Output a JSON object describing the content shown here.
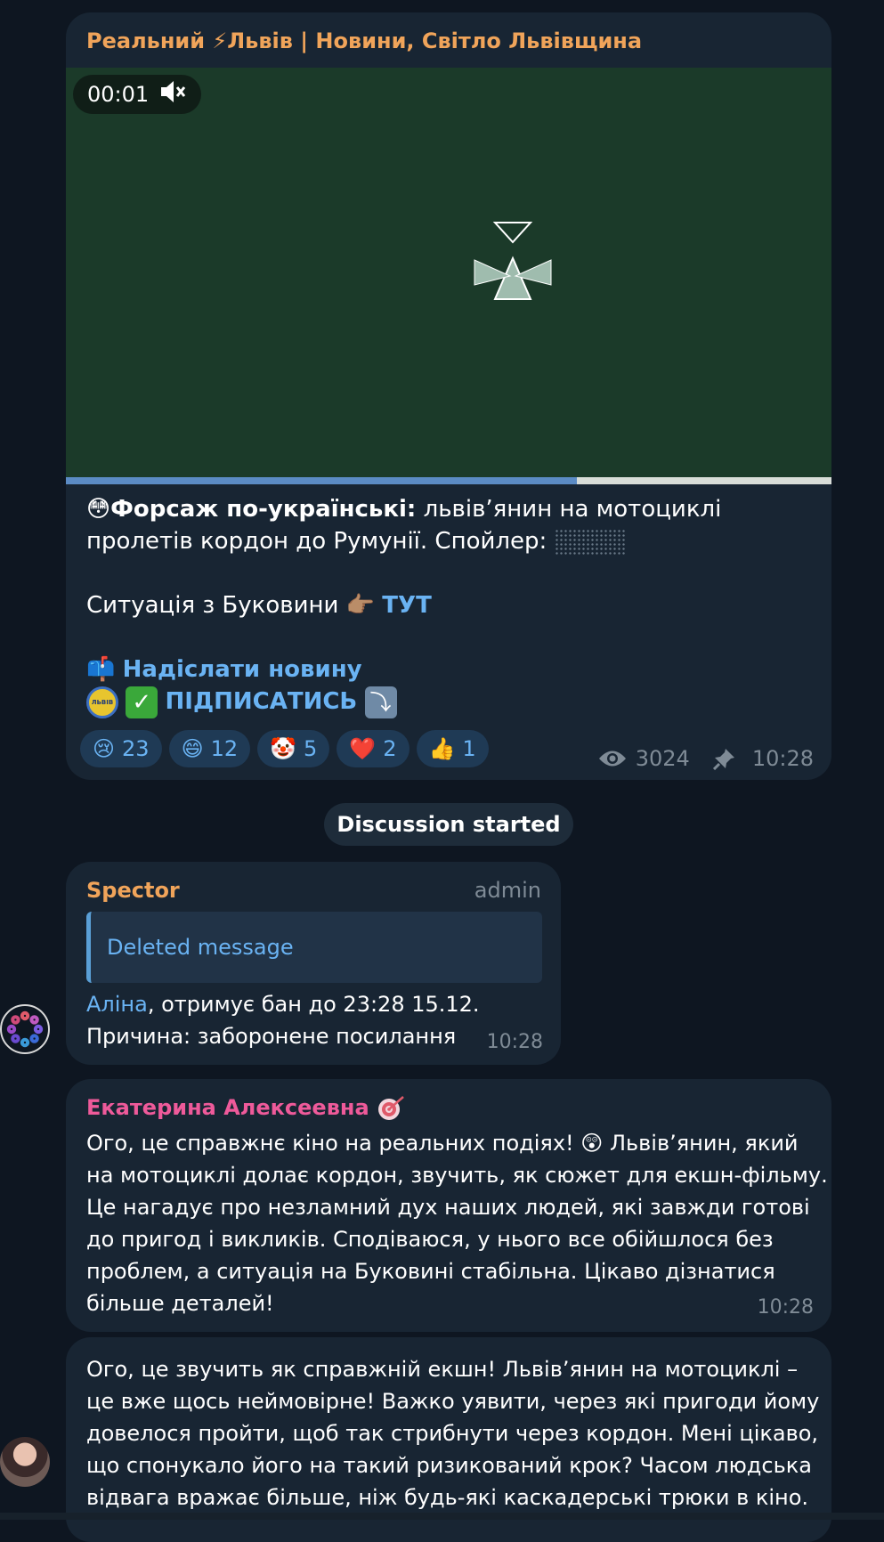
{
  "post": {
    "channel_title": "Реальний ⚡Львів | Новини, Світло Львівщина",
    "video": {
      "timestamp": "00:01",
      "progress": 0.667
    },
    "caption_emoji": "😳",
    "caption_bold": "Форсаж по-українські:",
    "caption_rest": " львів’янин на мотоциклі пролетів кордон до Румунії. Спойлер:",
    "situation_text": "Ситуація з Буковини 👉🏽 ",
    "situation_link": "ТУТ",
    "mailbox_emoji": "📫",
    "send_news_link": "Надіслати новину",
    "badge_text": "ЛЬВІВ",
    "subscribe_link": "ПІДПИСАТИСЬ",
    "reactions": [
      {
        "emoji": "😢",
        "count": "23"
      },
      {
        "emoji": "😄",
        "count": "12"
      },
      {
        "emoji": "🤡",
        "count": "5"
      },
      {
        "emoji": "❤️",
        "count": "2"
      },
      {
        "emoji": "👍",
        "count": "1"
      }
    ],
    "views": "3024",
    "time": "10:28"
  },
  "service_message": "Discussion started",
  "messages": [
    {
      "sender": "Spector",
      "sender_color": "#f0a45a",
      "role": "admin",
      "quote": "Deleted message",
      "mention": "Аліна",
      "text_line1": ", отримує бан до 23:28 15.12.",
      "text_line2": "Причина: заборонене посилання",
      "time": "10:28"
    },
    {
      "sender": "Екатерина Алексеевна",
      "sender_color": "#ee5a9a",
      "lines": [
        "Ого, це справжнє кіно на реальних подіях! 😲 Львів’янин, який",
        "на мотоциклі долає кордон, звучить, як сюжет для екшн-фільму.",
        "Це нагадує про незламний дух наших людей, які завжди готові",
        "до пригод і викликів. Сподіваюся, у нього все обійшлося без",
        "проблем, а ситуація на Буковині стабільна. Цікаво дізнатися",
        "більше деталей!"
      ],
      "time": "10:28"
    },
    {
      "lines": [
        "Ого, це звучить як справжній екшн! Львів’янин на мотоциклі –",
        "це вже щось неймовірне! Важко уявити, через які пригоди йому",
        "довелося пройти, щоб так стрибнути через кордон. Мені цікаво,",
        "що спонукало його на такий ризикований крок? Часом людська",
        "відвага вражає більше, ніж будь-які каскадерські трюки в кіно."
      ]
    }
  ],
  "colors": {
    "background": "#0e1621",
    "bubble": "#182533",
    "link": "#6ab3f3",
    "video_bg": "#1b3a29"
  }
}
